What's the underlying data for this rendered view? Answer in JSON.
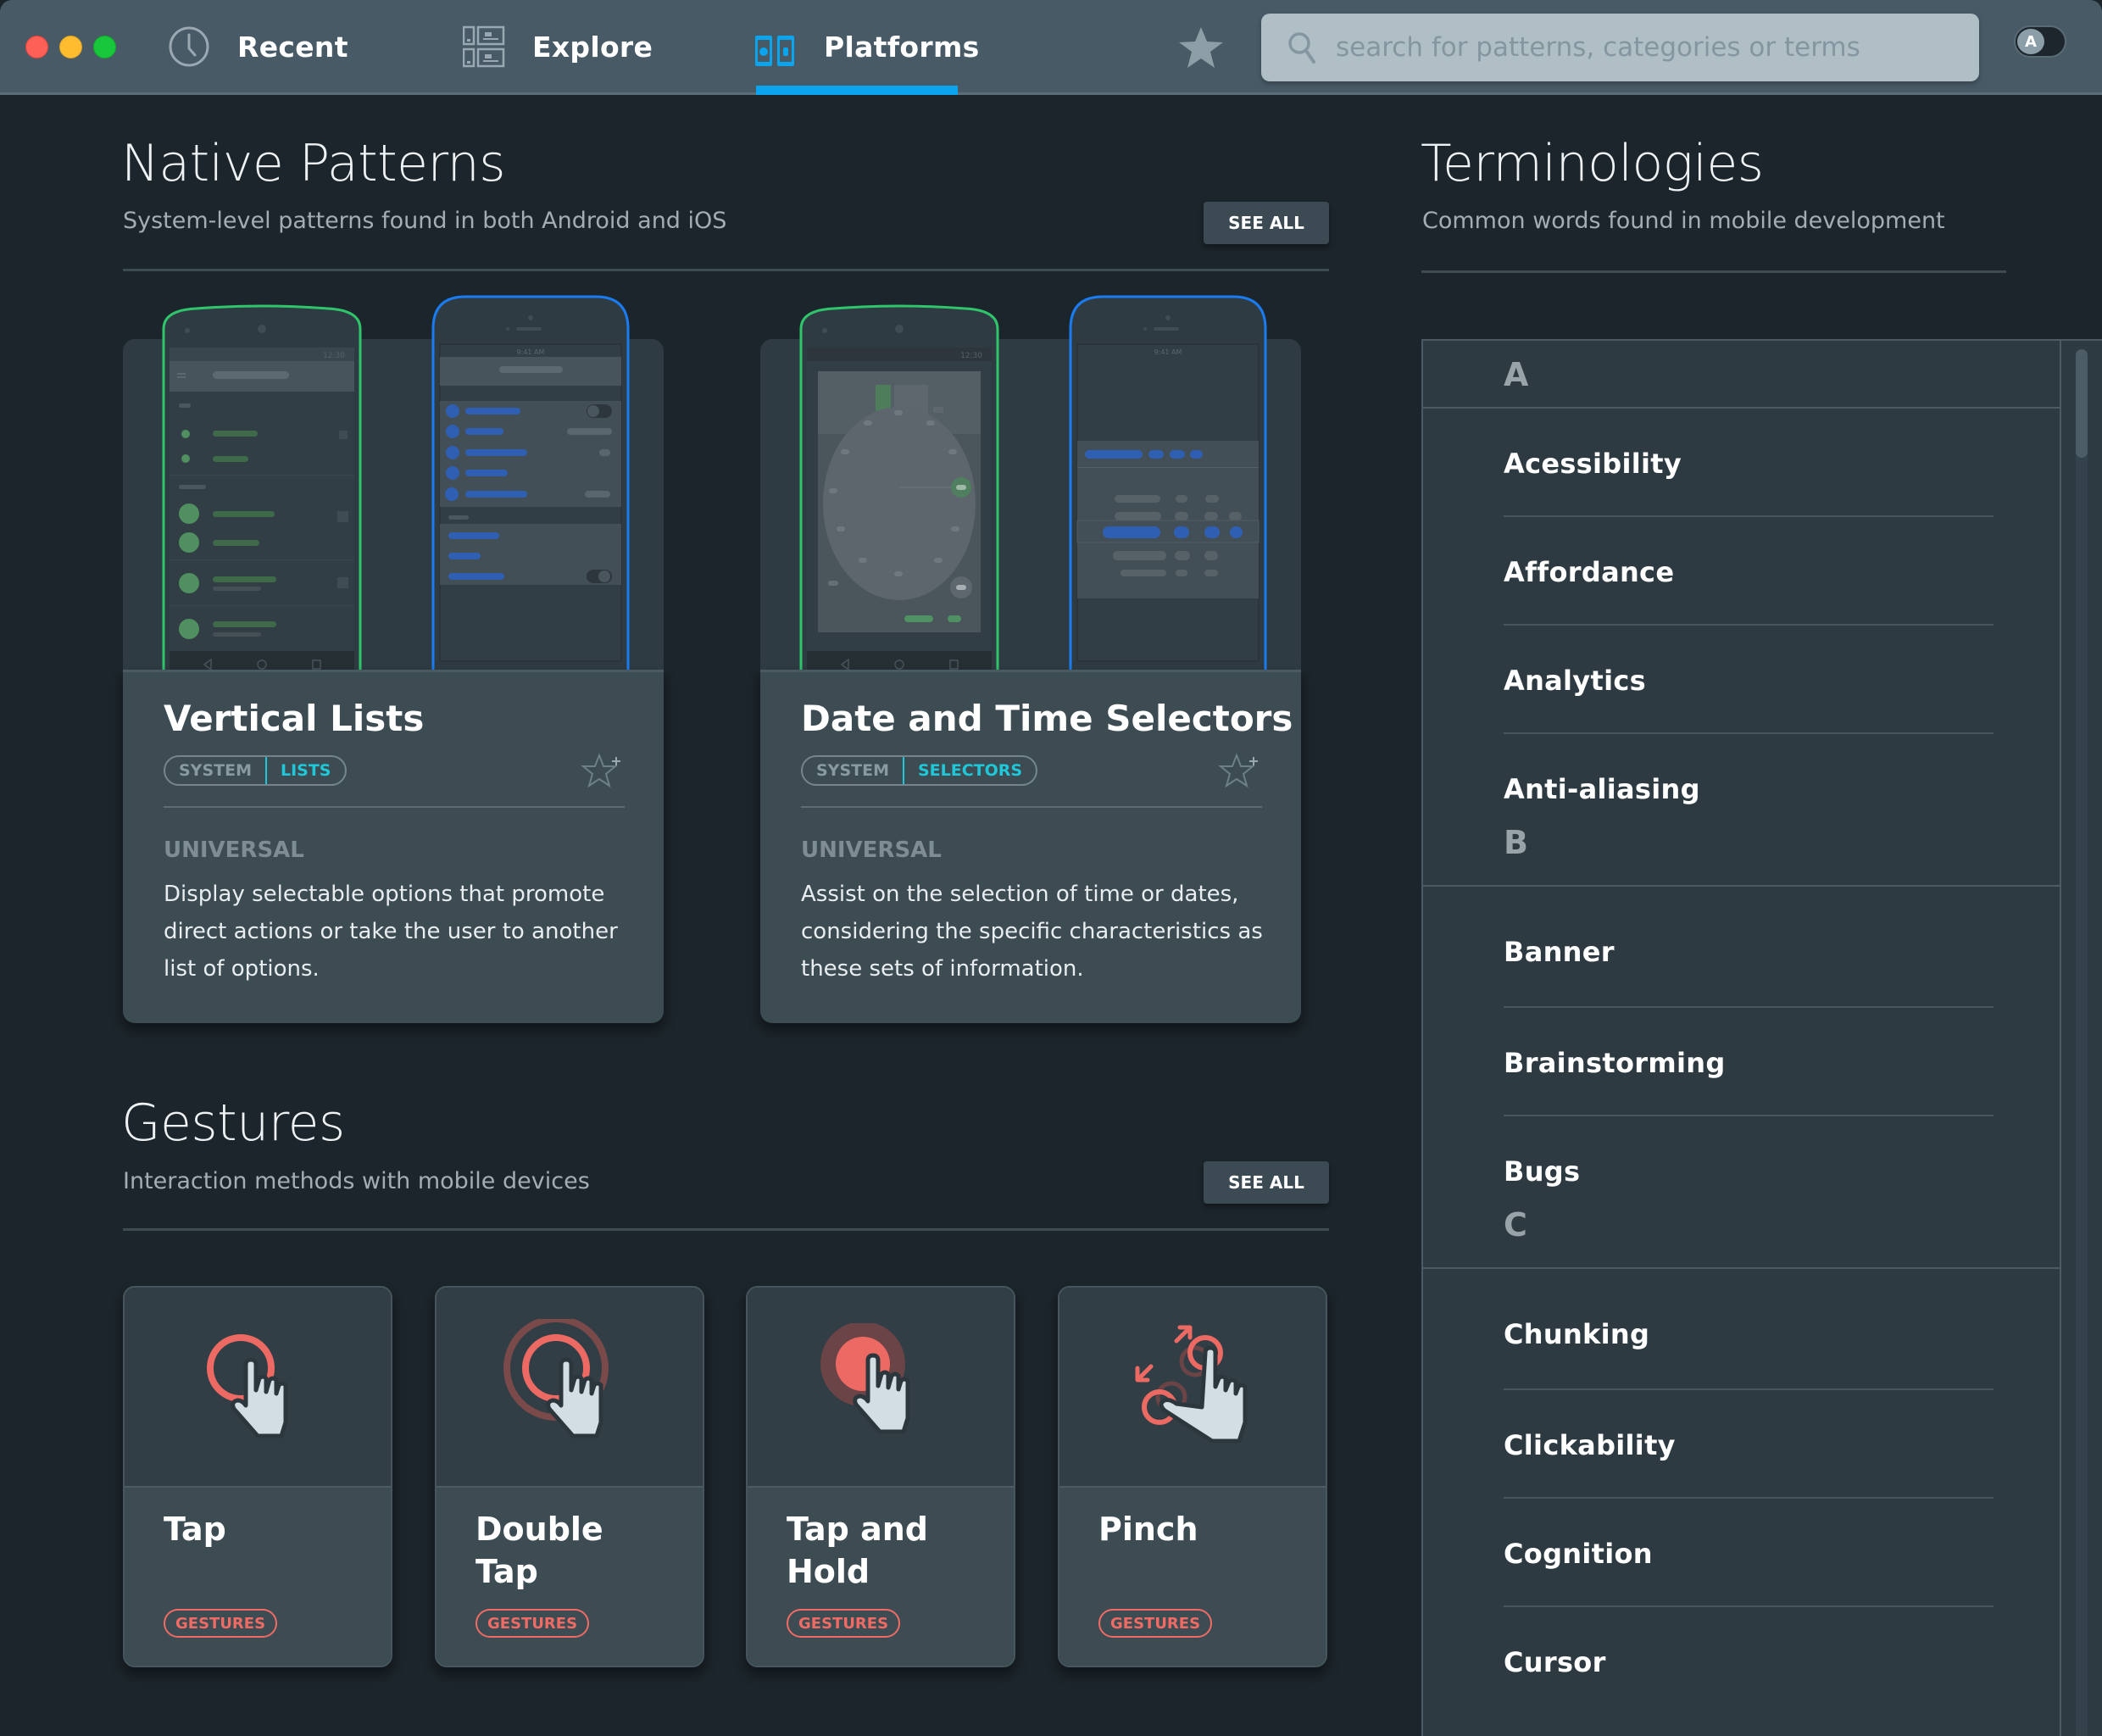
{
  "window": {
    "traffic_lights": [
      "close",
      "minimize",
      "zoom"
    ]
  },
  "nav": {
    "items": [
      {
        "label": "Recent",
        "icon": "clock-icon",
        "active": false
      },
      {
        "label": "Explore",
        "icon": "explore-grid-icon",
        "active": false
      },
      {
        "label": "Platforms",
        "icon": "platforms-icon",
        "active": true
      }
    ],
    "accent_color": "#0aa4ef",
    "favorites_icon": "star-icon"
  },
  "search": {
    "placeholder": "search for patterns, categories or terms",
    "value": ""
  },
  "theme_toggle": {
    "label": "A",
    "state": "off"
  },
  "native_patterns": {
    "title": "Native Patterns",
    "subtitle": "System-level patterns found in both Android and iOS",
    "see_all": "SEE ALL",
    "cards": [
      {
        "title": "Vertical Lists",
        "tags": [
          "SYSTEM",
          "LISTS"
        ],
        "platform_label": "UNIVERSAL",
        "description": "Display selectable options that promote direct actions or take the user to another list of options.",
        "android_status_time": "12:30",
        "ios_status_time": "9:41 AM"
      },
      {
        "title": "Date and Time Selectors",
        "tags": [
          "SYSTEM",
          "SELECTORS"
        ],
        "platform_label": "UNIVERSAL",
        "description": "Assist on the selection of time or dates, considering the specific characteristics as these sets of information.",
        "android_status_time": "12:30",
        "ios_status_time": "9:41 AM"
      }
    ],
    "tag_color": "#1fc8d8",
    "android_color": "#2fc56b",
    "ios_color": "#1a7cf0"
  },
  "gestures": {
    "title": "Gestures",
    "subtitle": "Interaction methods with mobile devices",
    "see_all": "SEE ALL",
    "tag_color": "#ef6b64",
    "cards": [
      {
        "title": "Tap",
        "tag": "GESTURES",
        "icon": "tap-gesture-icon"
      },
      {
        "title": "Double Tap",
        "tag": "GESTURES",
        "icon": "double-tap-gesture-icon"
      },
      {
        "title": "Tap and Hold",
        "tag": "GESTURES",
        "icon": "tap-and-hold-gesture-icon"
      },
      {
        "title": "Pinch",
        "tag": "GESTURES",
        "icon": "pinch-gesture-icon"
      }
    ]
  },
  "terminologies": {
    "title": "Terminologies",
    "subtitle": "Common words found in mobile development",
    "groups": [
      {
        "letter": "A",
        "terms": [
          "Acessibility",
          "Affordance",
          "Analytics",
          "Anti-aliasing"
        ]
      },
      {
        "letter": "B",
        "terms": [
          "Banner",
          "Brainstorming",
          "Bugs"
        ]
      },
      {
        "letter": "C",
        "terms": [
          "Chunking",
          "Clickability",
          "Cognition",
          "Cursor"
        ]
      }
    ]
  }
}
